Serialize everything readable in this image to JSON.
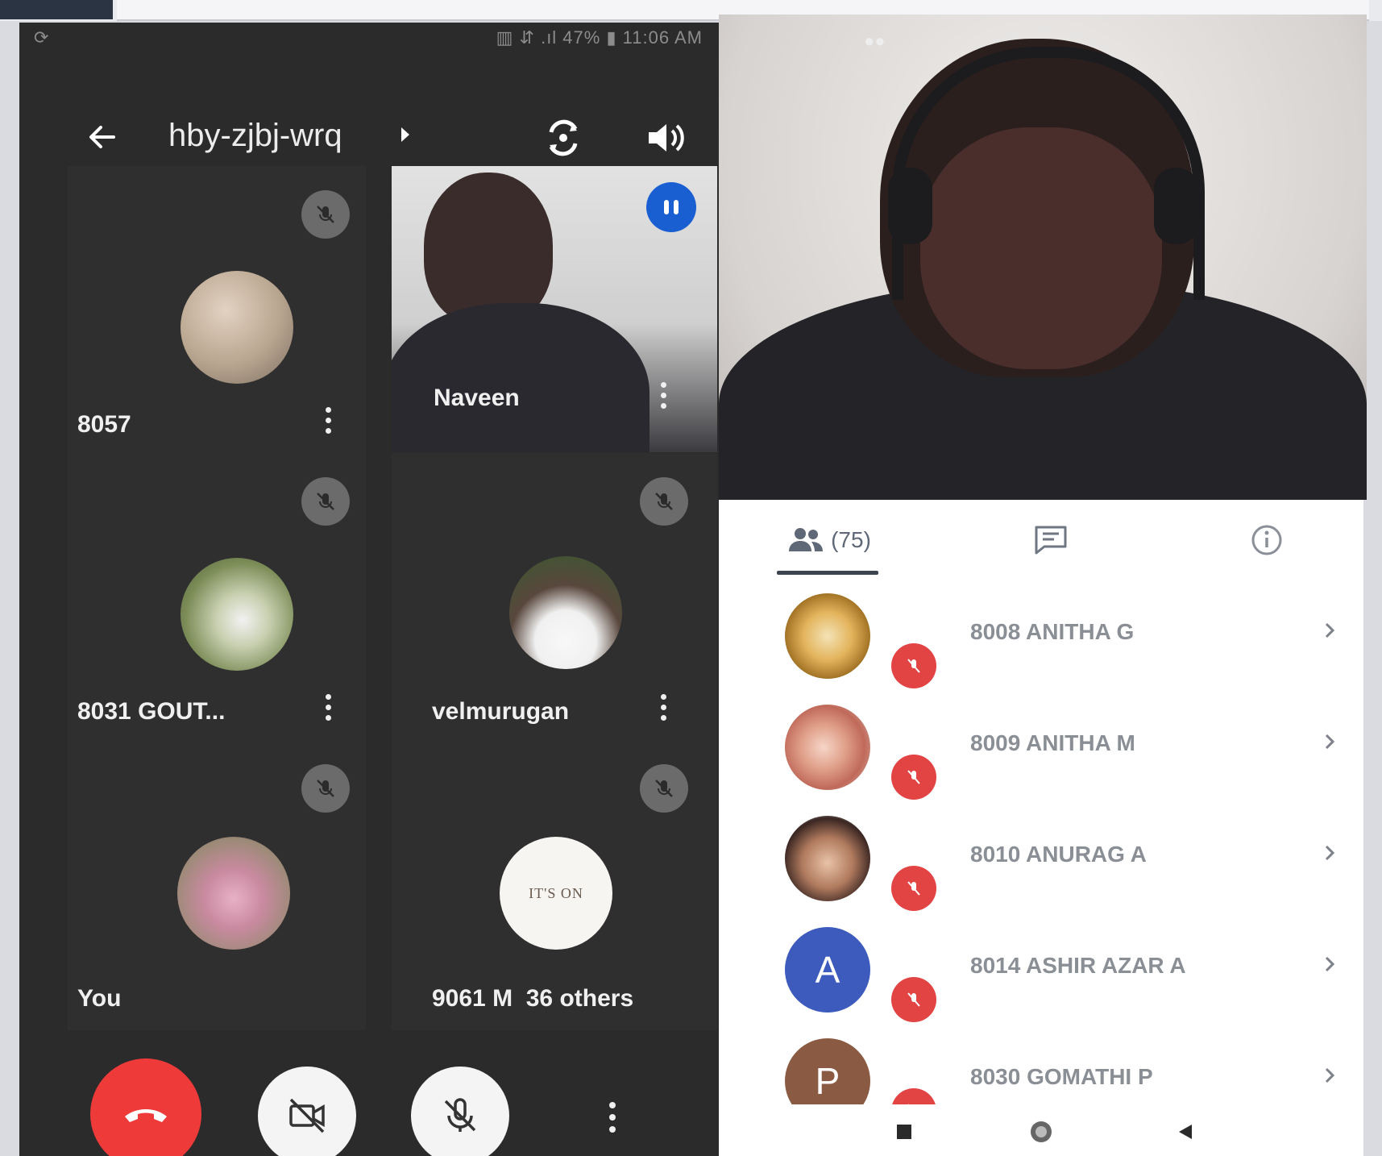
{
  "phone": {
    "status_bar": {
      "left": "⟳",
      "right": "▥ ⇵ .ıl 47% ▮ 11:06 AM"
    },
    "meeting": {
      "code": "hby-zjbj-wrq"
    },
    "tiles": [
      {
        "name": "8057",
        "muted": true,
        "type": "avatar"
      },
      {
        "name": "Naveen",
        "speaking": true,
        "type": "video"
      },
      {
        "name": "8031 GOUT...",
        "muted": true,
        "type": "avatar"
      },
      {
        "name": "velmurugan",
        "muted": true,
        "type": "avatar"
      },
      {
        "name": "You",
        "muted": true,
        "type": "avatar"
      },
      {
        "name": "9061 M  36 others",
        "muted": true,
        "type": "avatar",
        "avatar_text": "IT'S ON"
      }
    ]
  },
  "participants_panel": {
    "people_count": "(75)",
    "participants": [
      {
        "name": "8008 ANITHA G",
        "avatar_color": "#c8a23a",
        "initial": ""
      },
      {
        "name": "8009 ANITHA M",
        "avatar_color": "#c58a7e",
        "initial": ""
      },
      {
        "name": "8010 ANURAG A",
        "avatar_color": "#6d5348",
        "initial": ""
      },
      {
        "name": "8014 ASHIR AZAR A",
        "avatar_color": "#3c5bbd",
        "initial": "A"
      },
      {
        "name": "8030 GOMATHI P",
        "avatar_color": "#8a5a43",
        "initial": "P"
      }
    ]
  },
  "colors": {
    "phone_bg": "#2b2b2b",
    "hangup": "#ef3a3a",
    "speaking": "#1a5fd1",
    "muted_badge": "#e24444"
  }
}
